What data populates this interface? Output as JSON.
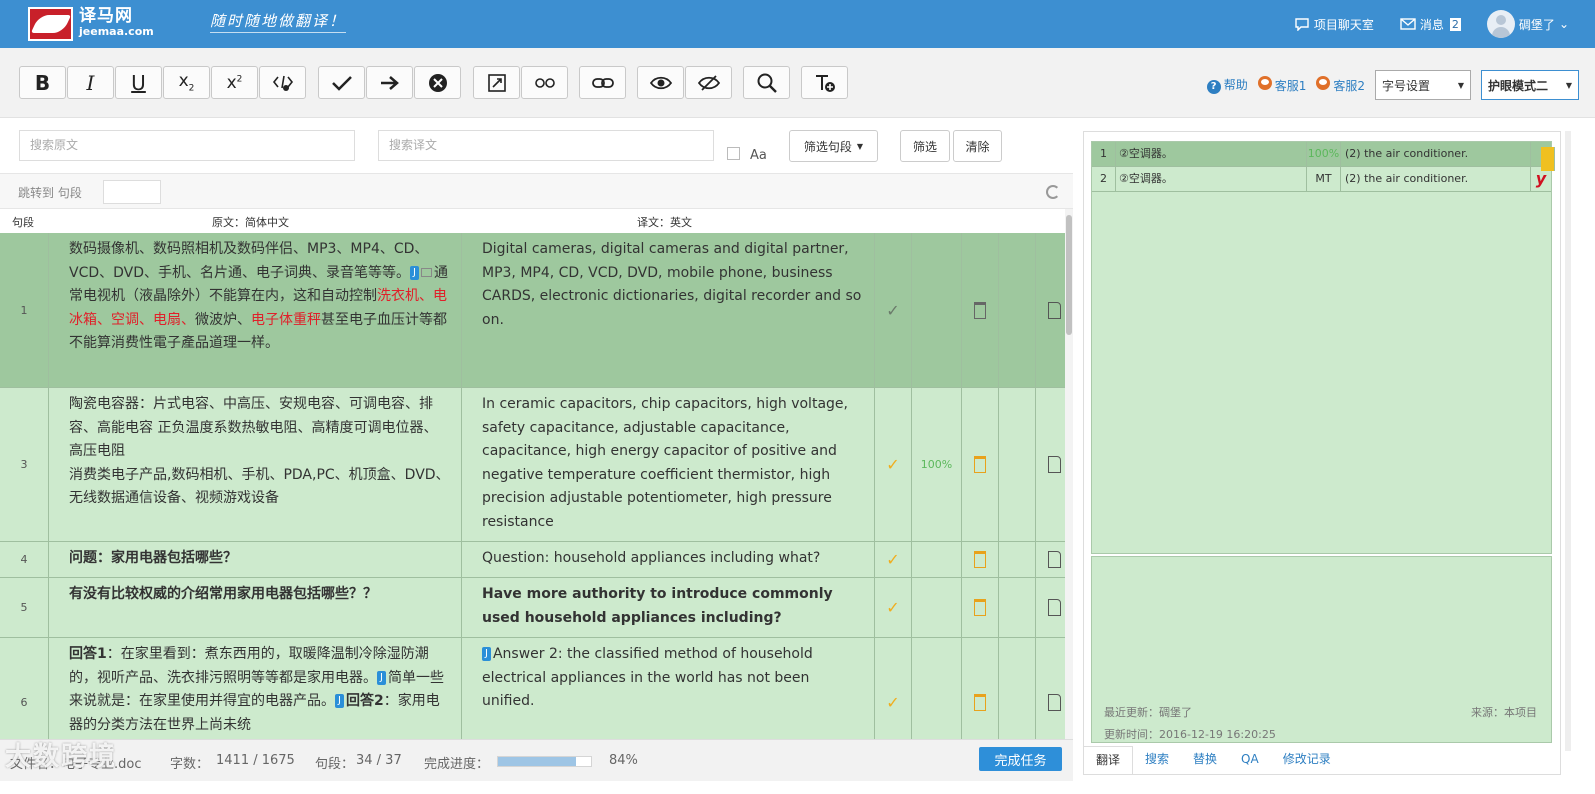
{
  "header": {
    "logo_cn": "译马网",
    "logo_en": "jeemaa.com",
    "slogan": "随时随地做翻译！",
    "chat_label": "项目聊天室",
    "msg_label": "消息",
    "msg_count": "2",
    "user_name": "碉堡了",
    "user_caret": "⌄"
  },
  "toolbar": {
    "help": "帮助",
    "cs1": "客服1",
    "cs2": "客服2",
    "font_setting": "字号设置",
    "eye_mode": "护眼模式二"
  },
  "search": {
    "source_placeholder": "搜索原文",
    "target_placeholder": "搜索译文",
    "aa": "Aa",
    "filter_select": "筛选句段",
    "filter_btn": "筛选",
    "clear_btn": "清除",
    "jump_label": "跳转到 句段"
  },
  "columns": {
    "seg": "句段",
    "source": "原文：简体中文",
    "target": "译文：英文"
  },
  "rows": [
    {
      "num": "1",
      "src_a": "数码摄像机、数码照相机及数码伴侣、MP3、MP4、CD、VCD、DVD、手机、名片通、电子词典、录音笔等等。",
      "src_b": "通常电视机（液晶除外）不能算在内，这和自动控制",
      "src_red": "洗衣机、电冰箱、空调、电扇、",
      "src_c": "微波炉、",
      "src_red2": "电子体重秤",
      "src_d": "甚至电子血压计等都不能算消费性電子產品道理一样。",
      "tgt": "Digital cameras, digital cameras and digital partner, MP3, MP4, CD, VCD, DVD, mobile phone, business CARDS, electronic dictionaries, digital recorder and so on.",
      "pct": ""
    },
    {
      "num": "3",
      "src_a": "陶瓷电容器：片式电容、中高压、安规电容、可调电容、排容、高能电容 正负温度系数热敏电阻、高精度可调电位器、高压电阻",
      "src_b": "消费类电子产品,数码相机、手机、PDA,PC、机顶盒、DVD、无线数据通信设备、视频游戏设备",
      "tgt": "In ceramic capacitors, chip capacitors, high voltage, safety capacitance, adjustable capacitance, capacitance, high energy capacitor of positive and negative temperature coefficient thermistor, high precision adjustable potentiometer, high pressure resistance",
      "pct": "100%"
    },
    {
      "num": "4",
      "src_a": "问题：家用电器包括哪些？",
      "tgt": "Question: household appliances including what?",
      "pct": ""
    },
    {
      "num": "5",
      "src_a": "有没有比较权威的介绍常用家用电器包括哪些？？",
      "tgt": "Have more authority to introduce commonly used household appliances including?",
      "pct": ""
    },
    {
      "num": "6",
      "src_bold1": "回答1",
      "src_a": "：在家里看到：煮东西用的，取暖降温制冷除湿防潮的，视听产品、洗衣排污照明等等都是家用电器。",
      "src_b": "简单一些来说就是：在家里使用并得宜的电器产品。",
      "src_bold2": "回答2",
      "src_c": "：家用电器的分类方法在世界上尚未统",
      "tgt": "Answer 2: the classified method of household electrical appliances in the world has not been unified.",
      "pct": ""
    }
  ],
  "tag_j": "J",
  "footer": {
    "file_label": "文件名：电子专业.doc",
    "words_label": "字数：",
    "words_value": "1411 / 1675",
    "seg_label": "句段：",
    "seg_value": "34 / 37",
    "progress_label": "完成进度：",
    "progress_value": "84%",
    "progress_fraction": 0.84,
    "finish_btn": "完成任务",
    "watermark": "大数跨境"
  },
  "tm": {
    "rows": [
      {
        "num": "1",
        "src": "②空调器。",
        "match": "100%",
        "tgt": "(2) the air conditioner."
      },
      {
        "num": "2",
        "src": "②空调器。",
        "match": "MT",
        "tgt": "(2) the air conditioner."
      }
    ],
    "last_update_label": "最近更新：碉堡了",
    "source_label": "来源：本项目",
    "update_time": "更新时间：2016-12-19 16:20:25"
  },
  "right_tabs": [
    "翻译",
    "搜索",
    "替换",
    "QA",
    "修改记录"
  ],
  "colors": {
    "topbar": "#3d8fd1",
    "row": "#cdeacd",
    "row_selected": "#9ec89e",
    "accent": "#2e8fd9"
  }
}
